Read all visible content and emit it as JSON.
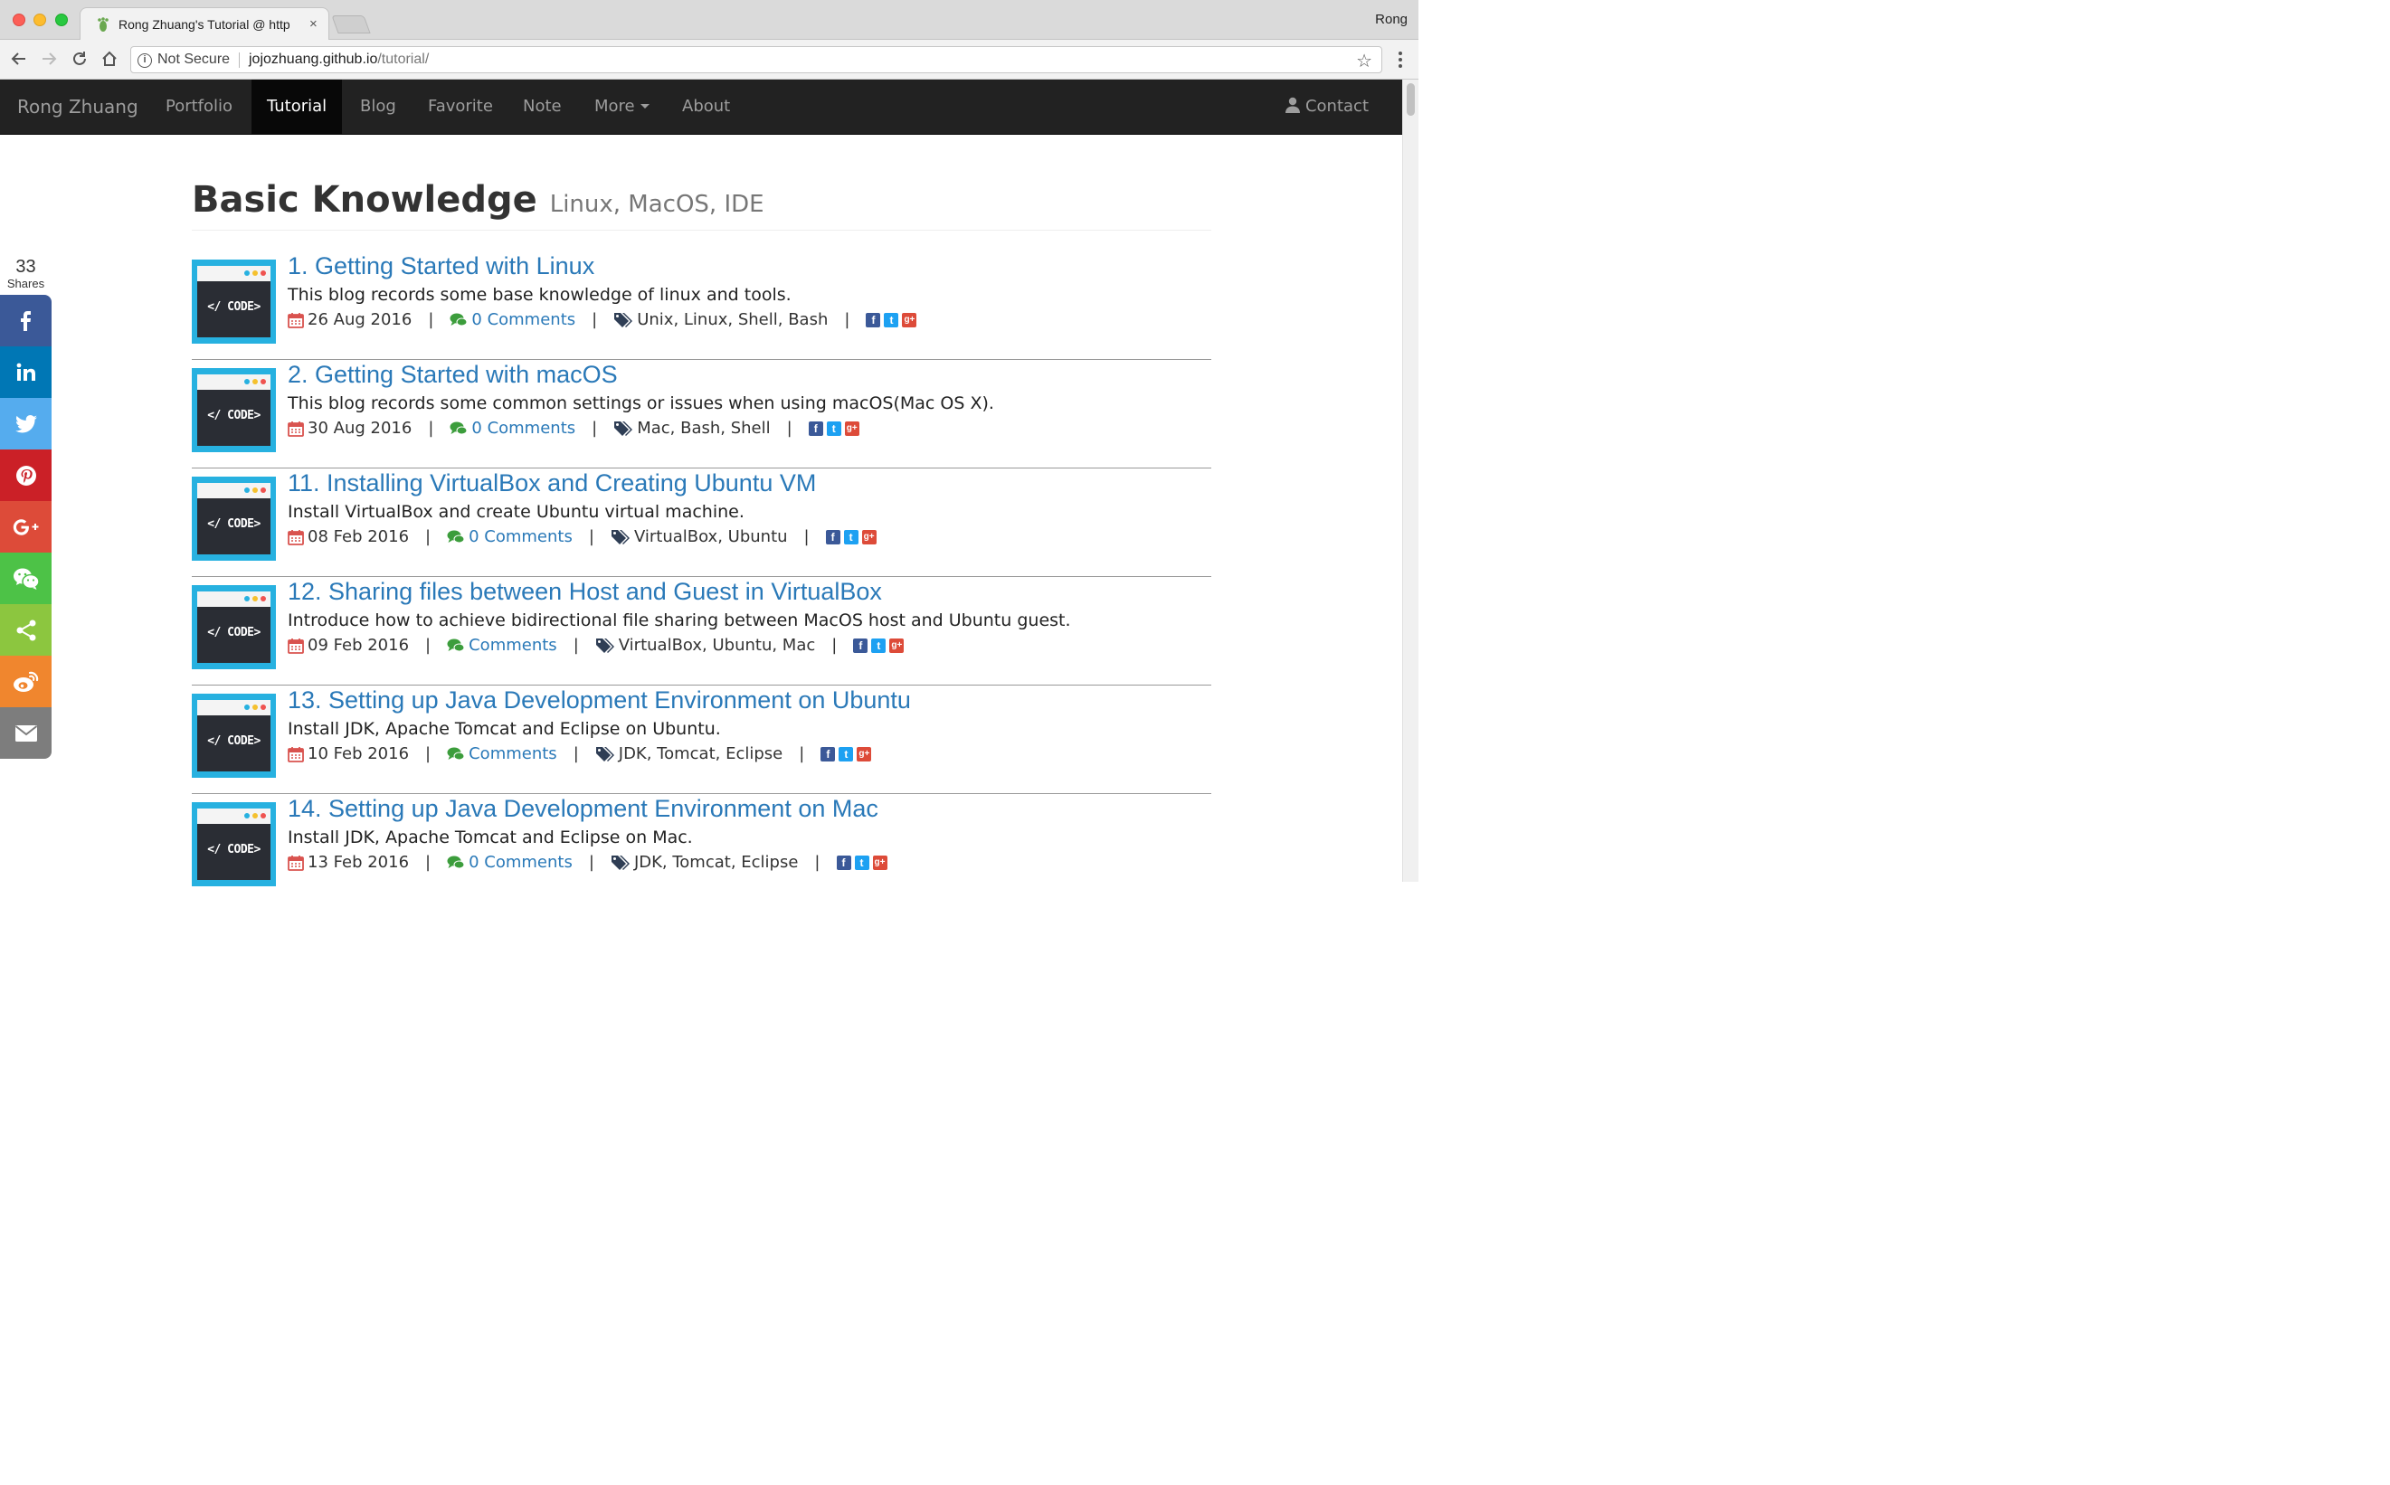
{
  "browser": {
    "tab_title": "Rong Zhuang's Tutorial @ http",
    "tab_close": "×",
    "profile_name": "Rong",
    "security_label": "Not Secure",
    "url_host": "jojozhuang.github.io",
    "url_path": "/tutorial/"
  },
  "navbar": {
    "brand": "Rong Zhuang",
    "items": [
      {
        "label": "Portfolio",
        "active": false
      },
      {
        "label": "Tutorial",
        "active": true
      },
      {
        "label": "Blog",
        "active": false
      },
      {
        "label": "Favorite",
        "active": false
      },
      {
        "label": "Note",
        "active": false
      },
      {
        "label": "More",
        "active": false
      },
      {
        "label": "About",
        "active": false
      }
    ],
    "contact": "Contact"
  },
  "share": {
    "count": "33",
    "label": "Shares",
    "buttons": [
      {
        "icon": "facebook-icon",
        "color": "#3b5998"
      },
      {
        "icon": "linkedin-icon",
        "color": "#0077b5"
      },
      {
        "icon": "twitter-icon",
        "color": "#55acee"
      },
      {
        "icon": "pinterest-icon",
        "color": "#cb2027"
      },
      {
        "icon": "google-plus-icon",
        "color": "#dd4b39"
      },
      {
        "icon": "wechat-icon",
        "color": "#4dc247"
      },
      {
        "icon": "share-icon",
        "color": "#8cc63f"
      },
      {
        "icon": "weibo-icon",
        "color": "#f0862e"
      },
      {
        "icon": "email-icon",
        "color": "#7d7d7d"
      }
    ]
  },
  "header": {
    "title": "Basic Knowledge",
    "subtitle": "Linux, MacOS, IDE"
  },
  "thumbnail_text": "</ CODE>",
  "separator": "|",
  "posts": [
    {
      "title": "1. Getting Started with Linux",
      "desc": "This blog records some base knowledge of linux and tools.",
      "date": "26 Aug 2016",
      "comments": "0 Comments",
      "tags": "Unix, Linux, Shell, Bash"
    },
    {
      "title": "2. Getting Started with macOS",
      "desc": "This blog records some common settings or issues when using macOS(Mac OS X).",
      "date": "30 Aug 2016",
      "comments": "0 Comments",
      "tags": "Mac, Bash, Shell"
    },
    {
      "title": "11. Installing VirtualBox and Creating Ubuntu VM",
      "desc": "Install VirtualBox and create Ubuntu virtual machine.",
      "date": "08 Feb 2016",
      "comments": "0 Comments",
      "tags": "VirtualBox, Ubuntu"
    },
    {
      "title": "12. Sharing files between Host and Guest in VirtualBox",
      "desc": "Introduce how to achieve bidirectional file sharing between MacOS host and Ubuntu guest.",
      "date": "09 Feb 2016",
      "comments": "Comments",
      "tags": "VirtualBox, Ubuntu, Mac"
    },
    {
      "title": "13. Setting up Java Development Environment on Ubuntu",
      "desc": "Install JDK, Apache Tomcat and Eclipse on Ubuntu.",
      "date": "10 Feb 2016",
      "comments": "Comments",
      "tags": "JDK, Tomcat, Eclipse"
    },
    {
      "title": "14. Setting up Java Development Environment on Mac",
      "desc": "Install JDK, Apache Tomcat and Eclipse on Mac.",
      "date": "13 Feb 2016",
      "comments": "0 Comments",
      "tags": "JDK, Tomcat, Eclipse"
    }
  ]
}
